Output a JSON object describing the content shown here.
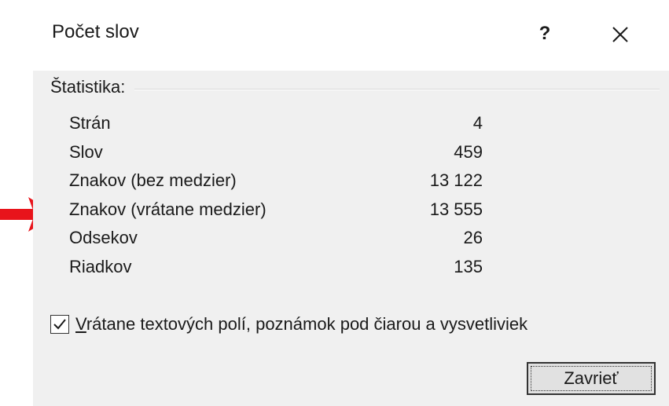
{
  "dialog": {
    "title": "Počet slov",
    "help_glyph": "?",
    "close_icon": "close-icon"
  },
  "statistics": {
    "label": "Štatistika:",
    "rows": [
      {
        "label": "Strán",
        "value": "4"
      },
      {
        "label": "Slov",
        "value": "459"
      },
      {
        "label": "Znakov (bez medzier)",
        "value": "13 122"
      },
      {
        "label": "Znakov (vrátane medzier)",
        "value": "13 555"
      },
      {
        "label": "Odsekov",
        "value": "26"
      },
      {
        "label": "Riadkov",
        "value": "135"
      }
    ]
  },
  "checkbox": {
    "checked": true,
    "label_accel": "V",
    "label_rest": "rátane textových polí, poznámok pod čiarou a vysvetliviek"
  },
  "buttons": {
    "close_label": "Zavrieť"
  },
  "annotation": {
    "icon": "red-arrow-icon",
    "color": "#e8141b",
    "points_to_row": 3
  },
  "colors": {
    "dialog_bg": "#f0f0f0",
    "title_bg": "#ffffff",
    "button_bg": "#e1e1e1"
  }
}
